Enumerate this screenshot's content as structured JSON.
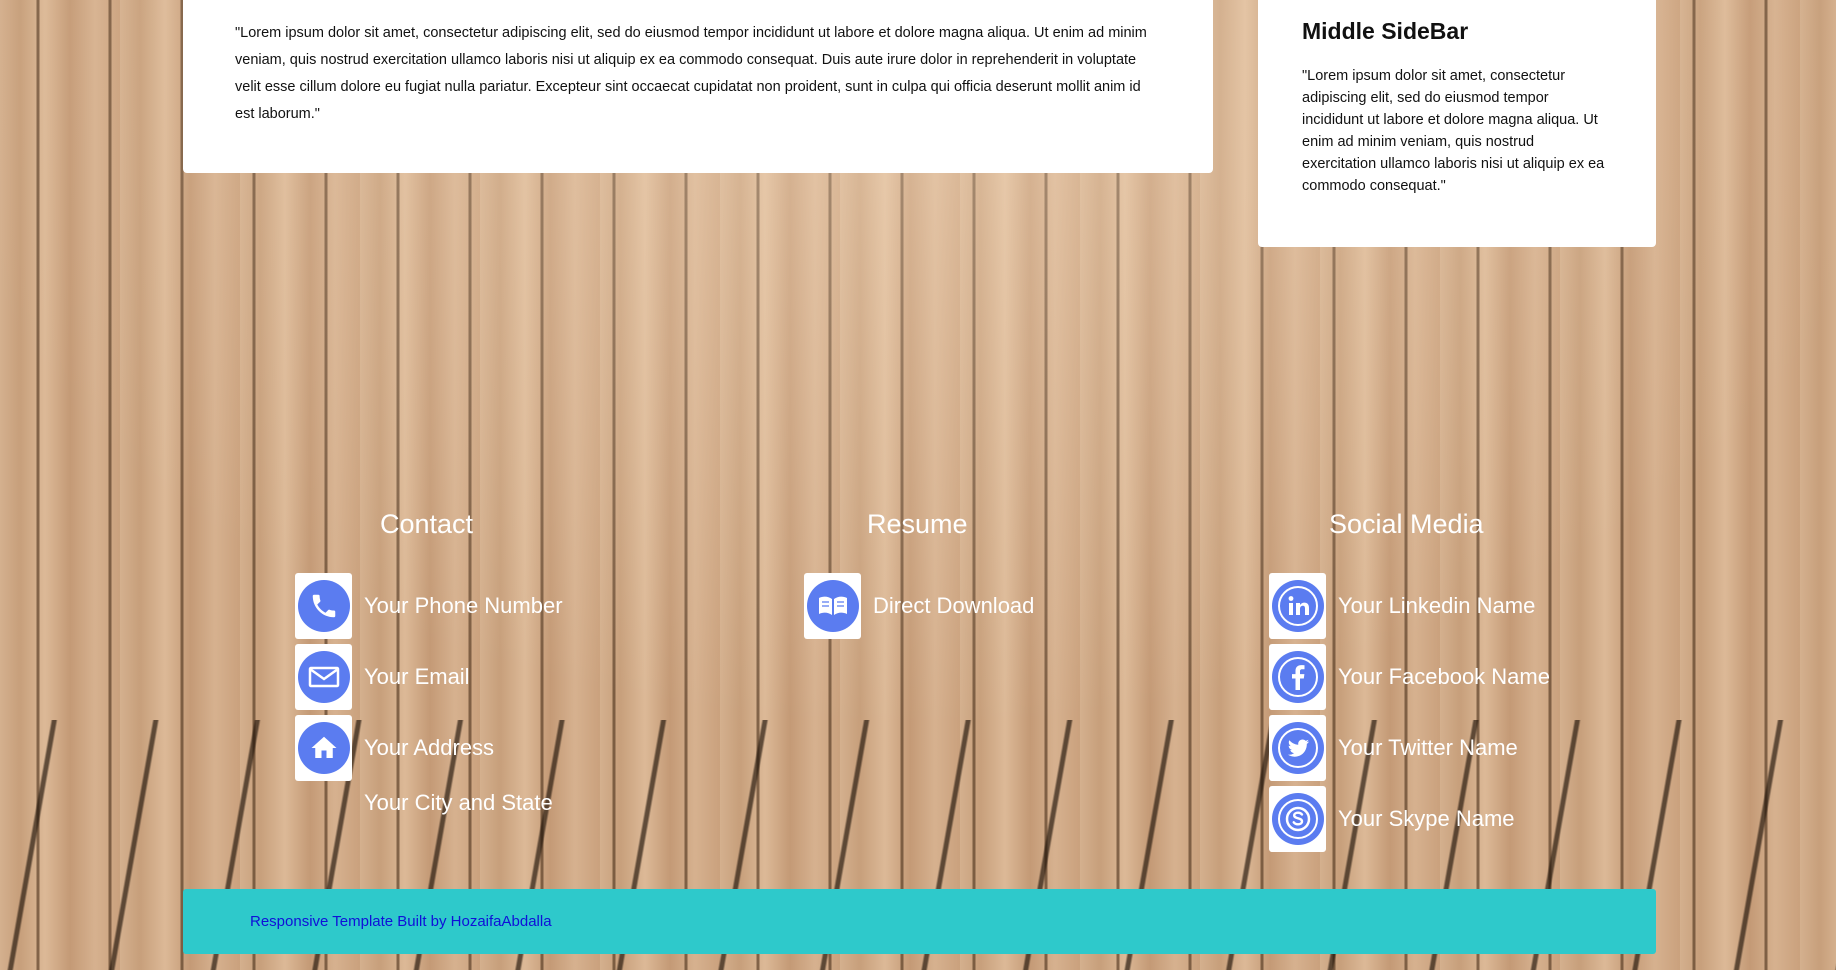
{
  "main": {
    "text": "\"Lorem ipsum dolor sit amet, consectetur adipiscing elit, sed do eiusmod tempor incididunt ut labore et dolore magna aliqua. Ut enim ad minim veniam, quis nostrud exercitation ullamco laboris nisi ut aliquip ex ea commodo consequat. Duis aute irure dolor in reprehenderit in voluptate velit esse cillum dolore eu fugiat nulla pariatur. Excepteur sint occaecat cupidatat non proident, sunt in culpa qui officia deserunt mollit anim id est laborum.\""
  },
  "sidebar": {
    "title": "Middle SideBar",
    "text": "\"Lorem ipsum dolor sit amet, consectetur adipiscing elit, sed do eiusmod tempor incididunt ut labore et dolore magna aliqua. Ut enim ad minim veniam, quis nostrud exercitation ullamco laboris nisi ut aliquip ex ea commodo consequat.\""
  },
  "contact": {
    "heading": "Contact",
    "phone": "Your Phone Number",
    "email": "Your Email",
    "address": "Your Address",
    "city_state": "Your City and State"
  },
  "resume": {
    "heading": "Resume",
    "download": "Direct Download"
  },
  "social": {
    "heading": "Social Media",
    "linkedin": "Your Linkedin Name",
    "facebook": "Your Facebook Name",
    "twitter": "Your Twitter Name",
    "skype": "Your Skype Name"
  },
  "footer": {
    "credit": "Responsive Template Built by HozaifaAbdalla"
  },
  "colors": {
    "icon_blue": "#5b7cf0",
    "footer_teal": "#2ec9cb",
    "footer_link": "#1010d8"
  },
  "icons": [
    "phone-icon",
    "envelope-icon",
    "home-icon",
    "book-icon",
    "linkedin-icon",
    "facebook-icon",
    "twitter-icon",
    "skype-icon"
  ]
}
